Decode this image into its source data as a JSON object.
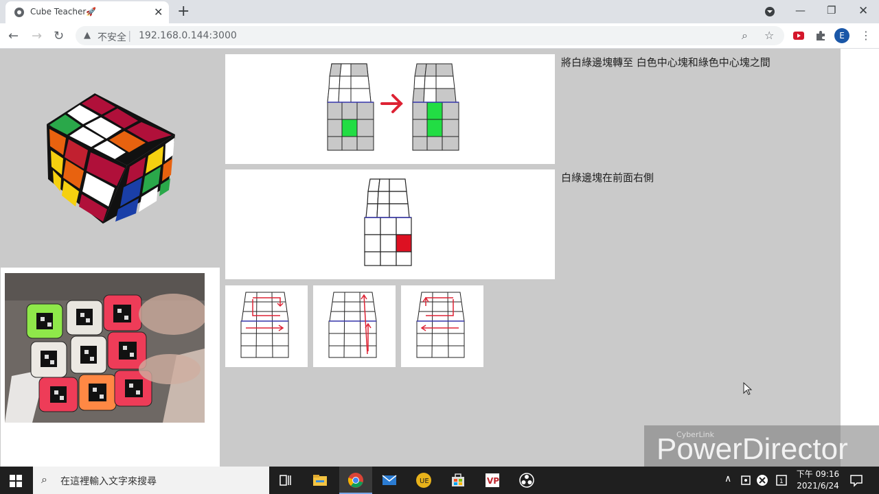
{
  "browser": {
    "tab_title": "Cube Teacher🚀",
    "insecure_label": "不安全",
    "url": "192.168.0.144:3000",
    "avatar_letter": "E"
  },
  "instructions": {
    "step1": "將白綠邊塊轉至 白色中心塊和綠色中心塊之間",
    "step2": "白綠邊塊在前面右側"
  },
  "taskbar": {
    "search_placeholder": "在這裡輸入文字來搜尋",
    "time": "下午 09:16",
    "date": "2021/6/24"
  },
  "watermark": {
    "brand_small": "CyberLink",
    "brand_big": "PowerDirector"
  },
  "colors": {
    "green": "#22dd44",
    "red": "#dd1122",
    "arrow": "#dd2233",
    "accent_blue": "#3333aa"
  }
}
